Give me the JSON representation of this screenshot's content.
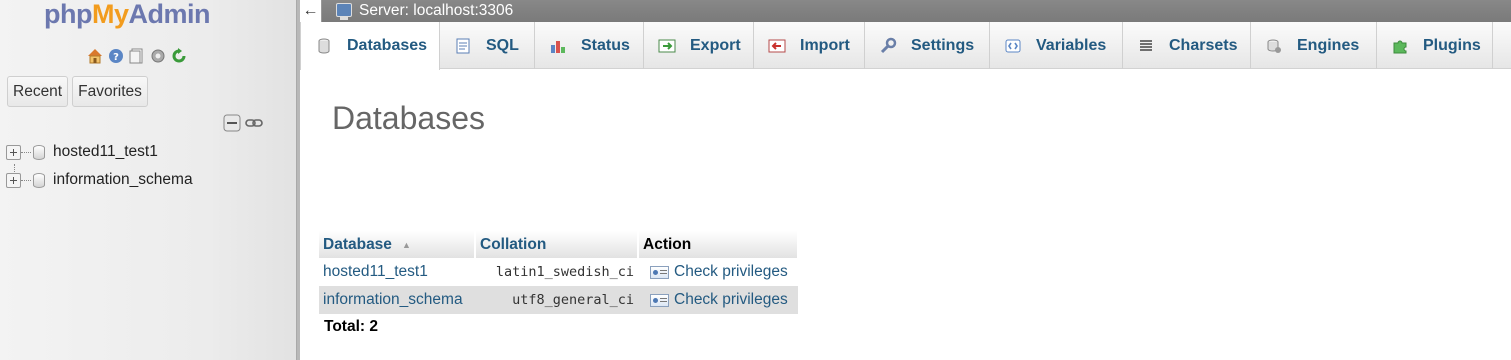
{
  "nav": {
    "logo": {
      "php": "php",
      "my": "My",
      "admin": "Admin"
    },
    "icons": [
      "home-icon",
      "help-icon",
      "docs-icon",
      "settings-icon",
      "reload-icon"
    ],
    "tabs": [
      {
        "label": "Recent"
      },
      {
        "label": "Favorites"
      }
    ],
    "tree": [
      {
        "label": "hosted11_test1"
      },
      {
        "label": "information_schema"
      }
    ]
  },
  "server_bar": {
    "back": "←",
    "label": "Server: localhost:3306"
  },
  "tabs": [
    {
      "label": "Databases",
      "icon": "database-icon"
    },
    {
      "label": "SQL",
      "icon": "sql-icon"
    },
    {
      "label": "Status",
      "icon": "status-icon"
    },
    {
      "label": "Export",
      "icon": "export-icon"
    },
    {
      "label": "Import",
      "icon": "import-icon"
    },
    {
      "label": "Settings",
      "icon": "wrench-icon"
    },
    {
      "label": "Variables",
      "icon": "variables-icon"
    },
    {
      "label": "Charsets",
      "icon": "charsets-icon"
    },
    {
      "label": "Engines",
      "icon": "engines-icon"
    },
    {
      "label": "Plugins",
      "icon": "plugins-icon"
    }
  ],
  "main": {
    "title": "Databases",
    "table": {
      "headers": {
        "database": "Database",
        "collation": "Collation",
        "action": "Action"
      },
      "rows": [
        {
          "database": "hosted11_test1",
          "collation": "latin1_swedish_ci",
          "action": "Check privileges"
        },
        {
          "database": "information_schema",
          "collation": "utf8_general_ci",
          "action": "Check privileges"
        }
      ]
    },
    "total": "Total: 2"
  },
  "colors": {
    "link": "#235a81",
    "logo_blue": "#6c78af",
    "logo_orange": "#f29c1e",
    "server_bar": "#7f7f7f"
  }
}
